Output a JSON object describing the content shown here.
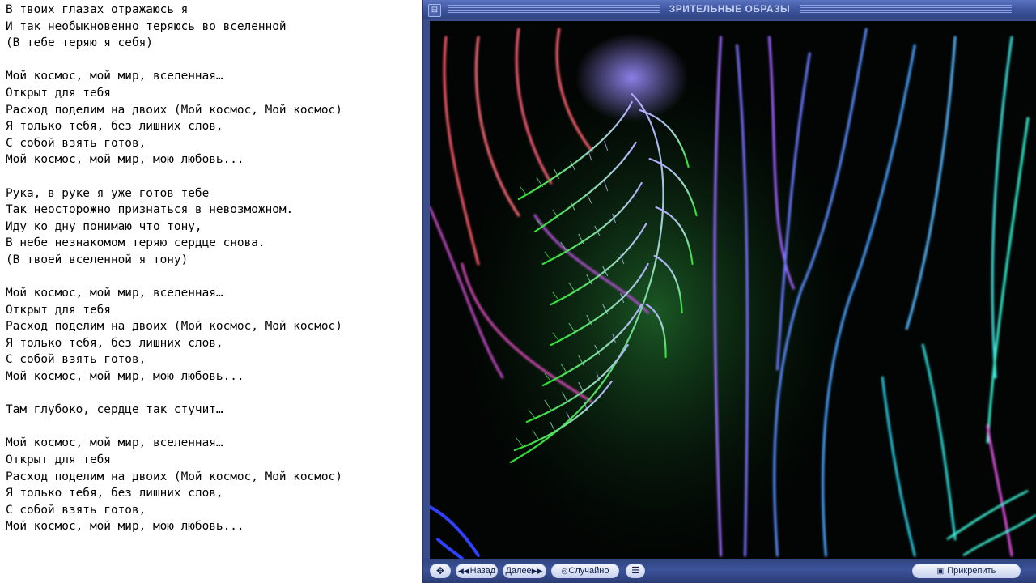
{
  "lyrics": {
    "text": "В твоих глазах отражаюсь я\nИ так необыкновенно теряюсь во вселенной\n(В тебе теряю я себя)\n\nМой космос, мой мир, вселенная…\nОткрыт для тебя\nРасход поделим на двоих (Мой космос, Мой космос)\nЯ только тебя, без лишних слов,\nС собой взять готов,\nМой космос, мой мир, мою любовь...\n\nРука, в руке я уже готов тебе\nТак неосторожно признаться в невозможном.\nИду ко дну понимаю что тону,\nВ небе незнакомом теряю сердце снова.\n(В твоей вселенной я тону)\n\nМой космос, мой мир, вселенная…\nОткрыт для тебя\nРасход поделим на двоих (Мой космос, Мой космос)\nЯ только тебя, без лишних слов,\nС собой взять готов,\nМой космос, мой мир, мою любовь...\n\nТам глубоко, сердце так стучит…\n\nМой космос, мой мир, вселенная…\nОткрыт для тебя\nРасход поделим на двоих (Мой космос, Мой космос)\nЯ только тебя, без лишних слов,\nС собой взять готов,\nМой космос, мой мир, мою любовь..."
  },
  "visualizer": {
    "title": "ЗРИТЕЛЬНЫЕ ОБРАЗЫ",
    "controls": {
      "back": "Назад",
      "next": "Далее",
      "random": "Случайно",
      "attach": "Прикрепить"
    }
  },
  "colors": {
    "window_frame": "#3a4d8c",
    "fern_top": "#a9a2ff",
    "fern_bottom": "#33dd33"
  }
}
